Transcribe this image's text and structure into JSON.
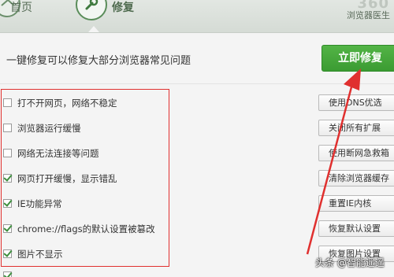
{
  "header": {
    "home_label": "首页",
    "repair_label": "修复",
    "brand_logo": "360",
    "brand_sub": "浏览器医生"
  },
  "main": {
    "headline": "一键修复可以修复大部分浏览器常见问题",
    "repair_button": "立即修复"
  },
  "items": [
    {
      "label": "打不开网页，网络不稳定",
      "checked": false,
      "action": "使用DNS优选"
    },
    {
      "label": "浏览器运行缓慢",
      "checked": false,
      "action": "关闭所有扩展"
    },
    {
      "label": "网络无法连接等问题",
      "checked": false,
      "action": "使用断网急救箱"
    },
    {
      "label": "网页打开缓慢，显示错乱",
      "checked": true,
      "action": "清除浏览器缓存"
    },
    {
      "label": "IE功能异常",
      "checked": true,
      "action": "重置IE内核"
    },
    {
      "label": "chrome://flags的默认设置被篡改",
      "checked": true,
      "action": "恢复默认设置"
    },
    {
      "label": "图片不显示",
      "checked": true,
      "action": "恢复图片设置"
    }
  ],
  "watermark": "头条 @智能遥遥",
  "colors": {
    "accent_green": "#3fa336",
    "highlight_red": "#e0302f"
  }
}
